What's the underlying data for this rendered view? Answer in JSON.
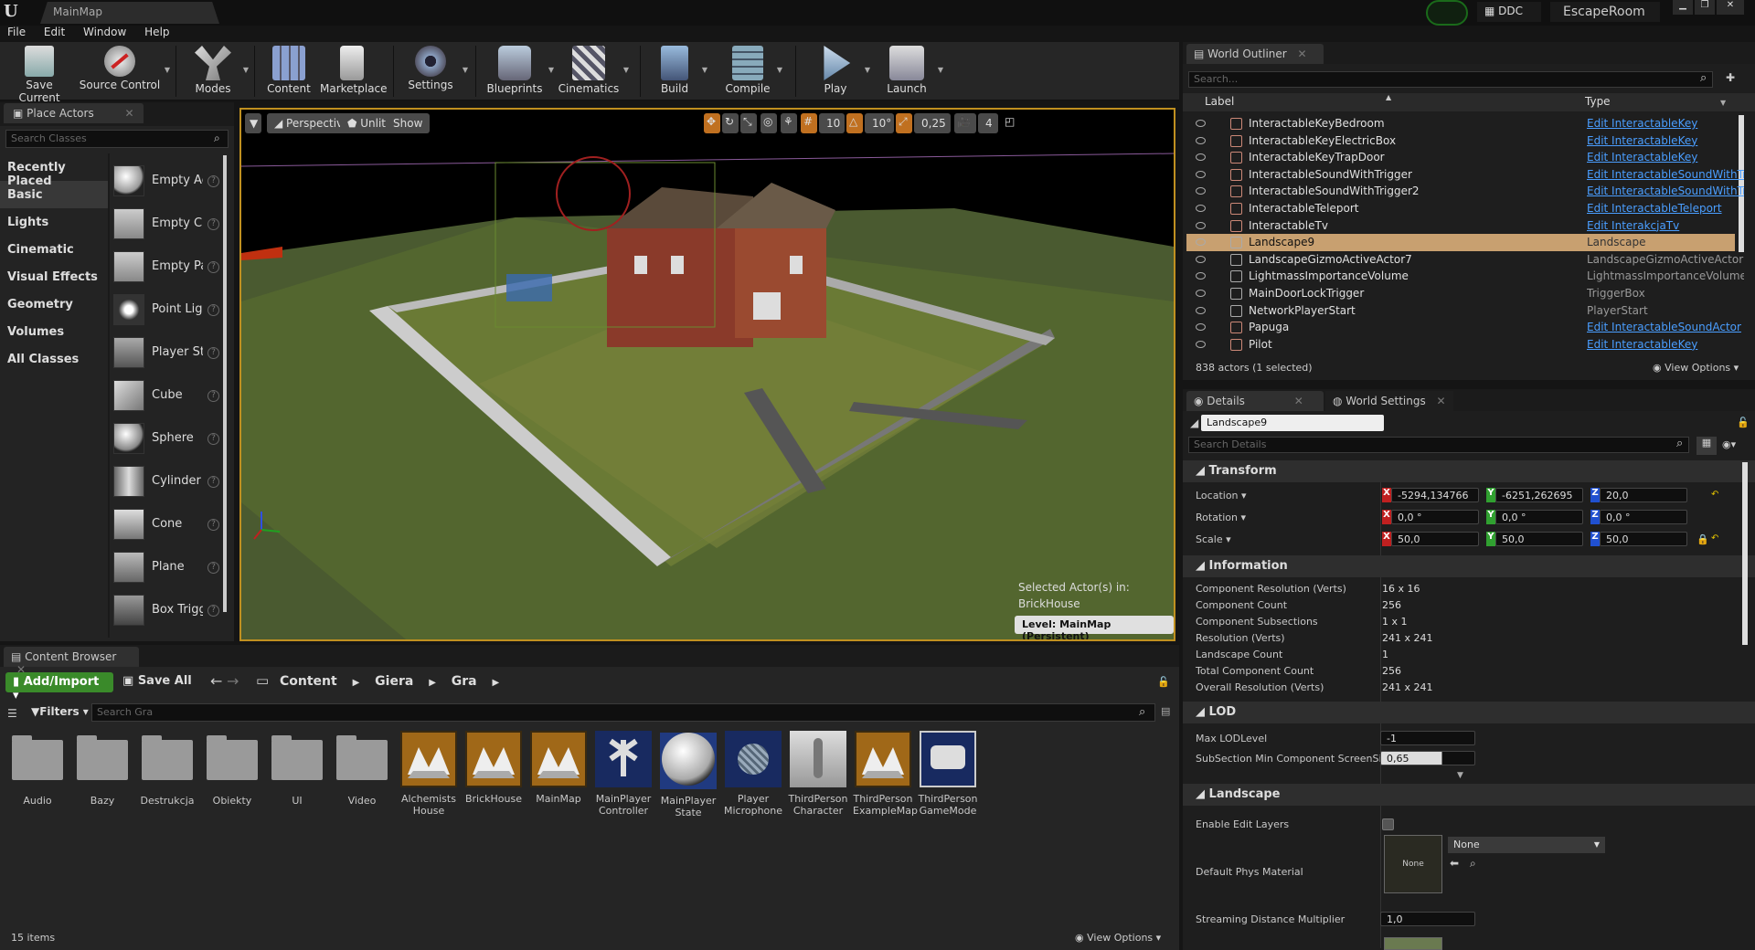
{
  "app": {
    "tab_title": "MainMap",
    "project": "EscapeRoom",
    "ddc": "DDC"
  },
  "menu": [
    "File",
    "Edit",
    "Window",
    "Help"
  ],
  "toolbar": [
    {
      "label": "Save Current",
      "icon": "save-icon"
    },
    {
      "label": "Source Control",
      "icon": "source-control-icon"
    },
    {
      "label": "Modes",
      "icon": "modes-icon"
    },
    {
      "label": "Content",
      "icon": "content-icon"
    },
    {
      "label": "Marketplace",
      "icon": "marketplace-icon"
    },
    {
      "label": "Settings",
      "icon": "settings-icon"
    },
    {
      "label": "Blueprints",
      "icon": "blueprints-icon"
    },
    {
      "label": "Cinematics",
      "icon": "cinematics-icon"
    },
    {
      "label": "Build",
      "icon": "build-icon"
    },
    {
      "label": "Compile",
      "icon": "compile-icon"
    },
    {
      "label": "Play",
      "icon": "play-icon"
    },
    {
      "label": "Launch",
      "icon": "launch-icon"
    }
  ],
  "place_actors": {
    "title": "Place Actors",
    "search_placeholder": "Search Classes",
    "categories": [
      "Recently Placed",
      "Basic",
      "Lights",
      "Cinematic",
      "Visual Effects",
      "Geometry",
      "Volumes",
      "All Classes"
    ],
    "selected_category": "Basic",
    "items": [
      "Empty Actor",
      "Empty Character",
      "Empty Pawn",
      "Point Light",
      "Player Start",
      "Cube",
      "Sphere",
      "Cylinder",
      "Cone",
      "Plane",
      "Box Trigger"
    ]
  },
  "viewport": {
    "perspective": "Perspective",
    "lit_mode": "Unlit",
    "show": "Show",
    "grid_snap": "10",
    "rotation_snap": "10°",
    "scale_snap": "0,25",
    "camera_speed": "4",
    "selected_actor_label": "Selected Actor(s) in:",
    "selected_actor_value": "BrickHouse",
    "level": "Level:  MainMap (Persistent)"
  },
  "content_browser": {
    "title": "Content Browser",
    "add_import": "Add/Import",
    "save_all": "Save All",
    "breadcrumb": [
      "Content",
      "Giera",
      "Gra"
    ],
    "filters": "Filters",
    "search_placeholder": "Search Gra",
    "folders": [
      "Audio",
      "Bazy",
      "Destrukcja",
      "Obiekty",
      "UI",
      "Video"
    ],
    "assets": [
      {
        "name": "Alchemists House",
        "kind": "map"
      },
      {
        "name": "BrickHouse",
        "kind": "map"
      },
      {
        "name": "MainMap",
        "kind": "map"
      },
      {
        "name": "MainPlayer Controller",
        "kind": "controller"
      },
      {
        "name": "MainPlayer State",
        "kind": "state"
      },
      {
        "name": "Player Microphone",
        "kind": "mic"
      },
      {
        "name": "ThirdPerson Character",
        "kind": "character"
      },
      {
        "name": "ThirdPerson ExampleMap",
        "kind": "map"
      },
      {
        "name": "ThirdPerson GameMode",
        "kind": "gamemode"
      }
    ],
    "item_count": "15 items",
    "view_options": "View Options"
  },
  "outliner": {
    "title": "World Outliner",
    "search_placeholder": "Search...",
    "col_label": "Label",
    "col_type": "Type",
    "rows": [
      {
        "label": "InteractableKeyBedroom",
        "type": "Edit InteractableKey",
        "link": true
      },
      {
        "label": "InteractableKeyElectricBox",
        "type": "Edit InteractableKey",
        "link": true
      },
      {
        "label": "InteractableKeyTrapDoor",
        "type": "Edit InteractableKey",
        "link": true
      },
      {
        "label": "InteractableSoundWithTrigger",
        "type": "Edit InteractableSoundWithTr",
        "link": true
      },
      {
        "label": "InteractableSoundWithTrigger2",
        "type": "Edit InteractableSoundWithTr",
        "link": true
      },
      {
        "label": "InteractableTeleport",
        "type": "Edit InteractableTeleport",
        "link": true
      },
      {
        "label": "InteractableTv",
        "type": "Edit InterakcjaTv",
        "link": true
      },
      {
        "label": "Landscape9",
        "type": "Landscape",
        "link": false,
        "selected": true
      },
      {
        "label": "LandscapeGizmoActiveActor7",
        "type": "LandscapeGizmoActiveActor",
        "link": false
      },
      {
        "label": "LightmassImportanceVolume",
        "type": "LightmassImportanceVolume",
        "link": false
      },
      {
        "label": "MainDoorLockTrigger",
        "type": "TriggerBox",
        "link": false
      },
      {
        "label": "NetworkPlayerStart",
        "type": "PlayerStart",
        "link": false
      },
      {
        "label": "Papuga",
        "type": "Edit InteractableSoundActor",
        "link": true
      },
      {
        "label": "Pilot",
        "type": "Edit InteractableKey",
        "link": true
      }
    ],
    "actor_count": "838 actors (1 selected)",
    "view_options": "View Options"
  },
  "details": {
    "tab_details": "Details",
    "tab_world": "World Settings",
    "actor_name": "Landscape9",
    "search_placeholder": "Search Details",
    "transform": {
      "title": "Transform",
      "location_label": "Location",
      "rotation_label": "Rotation",
      "scale_label": "Scale",
      "location": [
        "-5294,134766",
        "-6251,262695",
        "20,0"
      ],
      "rotation": [
        "0,0 °",
        "0,0 °",
        "0,0 °"
      ],
      "scale": [
        "50,0",
        "50,0",
        "50,0"
      ]
    },
    "information": {
      "title": "Information",
      "rows": [
        {
          "k": "Component Resolution (Verts)",
          "v": "16 x 16"
        },
        {
          "k": "Component Count",
          "v": "256"
        },
        {
          "k": "Component Subsections",
          "v": "1 x 1"
        },
        {
          "k": "Resolution (Verts)",
          "v": "241 x 241"
        },
        {
          "k": "Landscape Count",
          "v": "1"
        },
        {
          "k": "Total Component Count",
          "v": "256"
        },
        {
          "k": "Overall Resolution (Verts)",
          "v": "241 x 241"
        }
      ]
    },
    "lod": {
      "title": "LOD",
      "max_lod_label": "Max LODLevel",
      "max_lod": "-1",
      "subsection_label": "SubSection Min Component ScreenSize",
      "subsection": "0,65"
    },
    "landscape": {
      "title": "Landscape",
      "edit_layers_label": "Enable Edit Layers",
      "phys_label": "Default Phys Material",
      "phys_thumb": "None",
      "phys_value": "None",
      "streaming_label": "Streaming Distance Multiplier",
      "streaming": "1,0"
    }
  },
  "colors": {
    "accent_orange": "#c09020",
    "link": "#4a9eff",
    "selected_row": "#c8a070",
    "add_button": "#3a8a2a"
  }
}
